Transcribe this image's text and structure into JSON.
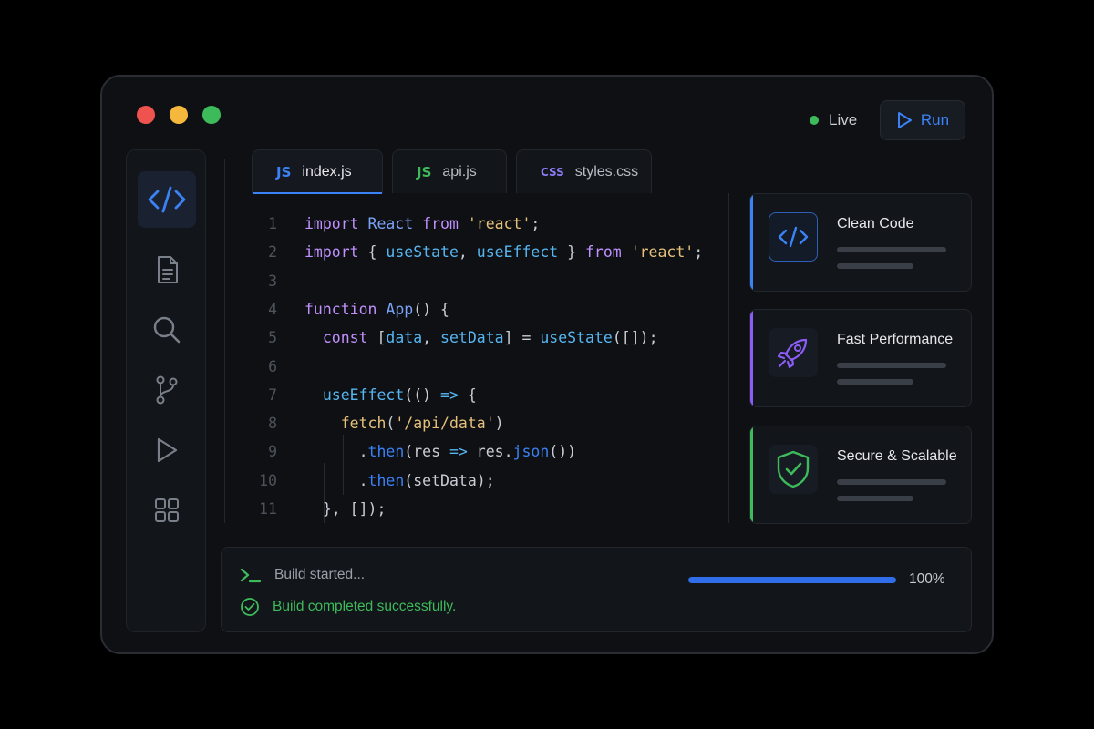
{
  "header": {
    "status_label": "Live",
    "run_label": "Run",
    "colors": {
      "status": "#3dbb5a",
      "accent": "#3b82f6"
    }
  },
  "activity_bar": {
    "items": [
      {
        "icon": "code-icon",
        "active": true
      },
      {
        "icon": "file-icon",
        "active": false
      },
      {
        "icon": "search-icon",
        "active": false
      },
      {
        "icon": "git-branch-icon",
        "active": false
      },
      {
        "icon": "play-icon",
        "active": false
      },
      {
        "icon": "grid-icon",
        "active": false
      }
    ]
  },
  "tabs": [
    {
      "badge": "JS",
      "label": "index.js",
      "badge_color": "#3b82f6",
      "active": true
    },
    {
      "badge": "JS",
      "label": "api.js",
      "badge_color": "#3dbb5a",
      "active": false
    },
    {
      "badge": "CSS",
      "label": "styles.css",
      "badge_color": "#8b7cf6",
      "active": false
    }
  ],
  "editor": {
    "lines": [
      {
        "n": "1",
        "tokens": [
          [
            "kw",
            "import"
          ],
          [
            "p",
            " "
          ],
          [
            "id",
            "React"
          ],
          [
            "p",
            " "
          ],
          [
            "kw",
            "from"
          ],
          [
            "p",
            " "
          ],
          [
            "str",
            "'react'"
          ],
          [
            "p",
            ";"
          ]
        ]
      },
      {
        "n": "2",
        "tokens": [
          [
            "kw",
            "import"
          ],
          [
            "p",
            " { "
          ],
          [
            "var",
            "useState"
          ],
          [
            "p",
            ", "
          ],
          [
            "var",
            "useEffect"
          ],
          [
            "p",
            " } "
          ],
          [
            "kw",
            "from"
          ],
          [
            "p",
            " "
          ],
          [
            "str",
            "'react'"
          ],
          [
            "p",
            ";"
          ]
        ]
      },
      {
        "n": "3",
        "tokens": []
      },
      {
        "n": "4",
        "tokens": [
          [
            "kw",
            "function"
          ],
          [
            "p",
            " "
          ],
          [
            "id",
            "App"
          ],
          [
            "p",
            "() {"
          ]
        ]
      },
      {
        "n": "5",
        "tokens": [
          [
            "p",
            "  "
          ],
          [
            "kw",
            "const"
          ],
          [
            "p",
            " ["
          ],
          [
            "var",
            "data"
          ],
          [
            "p",
            ", "
          ],
          [
            "var",
            "setData"
          ],
          [
            "p",
            "] = "
          ],
          [
            "var",
            "useState"
          ],
          [
            "p",
            "([]);"
          ]
        ]
      },
      {
        "n": "6",
        "tokens": []
      },
      {
        "n": "7",
        "tokens": [
          [
            "p",
            "  "
          ],
          [
            "var",
            "useEffect"
          ],
          [
            "p",
            "(() "
          ],
          [
            "arrow",
            "=>"
          ],
          [
            "p",
            " {"
          ]
        ]
      },
      {
        "n": "8",
        "tokens": [
          [
            "p",
            "    "
          ],
          [
            "call",
            "fetch"
          ],
          [
            "p",
            "("
          ],
          [
            "str",
            "'/api/data'"
          ],
          [
            "p",
            ")"
          ]
        ]
      },
      {
        "n": "9",
        "tokens": [
          [
            "p",
            "      ."
          ],
          [
            "method",
            "then"
          ],
          [
            "p",
            "(res "
          ],
          [
            "arrow",
            "=>"
          ],
          [
            "p",
            " res."
          ],
          [
            "method",
            "json"
          ],
          [
            "p",
            "())"
          ]
        ]
      },
      {
        "n": "10",
        "tokens": [
          [
            "p",
            "      ."
          ],
          [
            "method",
            "then"
          ],
          [
            "p",
            "(setData);"
          ]
        ]
      },
      {
        "n": "11",
        "tokens": [
          [
            "p",
            "  }, []);"
          ]
        ]
      }
    ]
  },
  "cards": [
    {
      "title": "Clean Code",
      "icon": "code-icon",
      "accent": "#3b82f6"
    },
    {
      "title": "Fast Performance",
      "icon": "rocket-icon",
      "accent": "#8b5cf6"
    },
    {
      "title": "Secure & Scalable",
      "icon": "shield-check-icon",
      "accent": "#3dbb5a"
    }
  ],
  "terminal": {
    "line1": "Build started...",
    "line2": "Build completed successfully.",
    "progress_percent": 100,
    "progress_label": "100%",
    "colors": {
      "success": "#3dbb5a",
      "progress": "#2f6ee8"
    }
  }
}
